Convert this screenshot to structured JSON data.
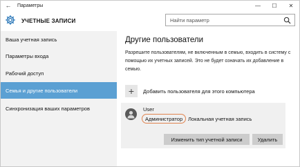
{
  "window": {
    "title": "Параметры",
    "back_glyph": "←",
    "minimize_glyph": "—",
    "maximize_glyph": "☐",
    "close_glyph": "✕"
  },
  "header": {
    "app_title": "УЧЕТНЫЕ ЗАПИСИ",
    "app_icon": "gear-icon",
    "search_placeholder": "Найти параметр",
    "search_icon": "search-icon"
  },
  "sidebar": {
    "items": [
      {
        "label": "Ваша учетная запись",
        "active": false
      },
      {
        "label": "Параметры входа",
        "active": false
      },
      {
        "label": "Рабочий доступ",
        "active": false
      },
      {
        "label": "Семья и другие пользователи",
        "active": true
      },
      {
        "label": "Синхронизация ваших параметров",
        "active": false
      }
    ]
  },
  "main": {
    "title": "Другие пользователи",
    "description": "Разрешите пользователям, не включенным в семью, входить в систему с помощью их учетных записей. Это не будет означать их добавление в семью.",
    "add_user": {
      "icon_glyph": "+",
      "label": "Добавить пользователя для этого компьютера"
    },
    "user": {
      "name": "User",
      "role": "Администратор",
      "account_type": "Локальная учетная запись",
      "change_type_button": "Изменить тип учетной записи",
      "delete_button": "Удалить"
    }
  },
  "colors": {
    "accent": "#5ba0d3",
    "highlight_ring": "#e0834e",
    "sidebar_bg": "#f2f2f2",
    "card_bg": "#f0f0f0",
    "button_bg": "#cccccc"
  }
}
